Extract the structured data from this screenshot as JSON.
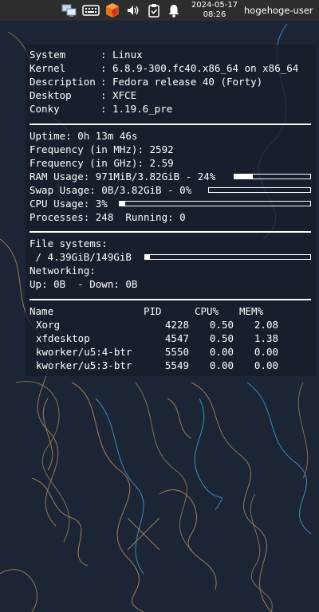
{
  "panel": {
    "date": "2024-05-17",
    "time": "08:26",
    "user": "hogehoge-user",
    "icons": [
      "network-icon",
      "keyboard-icon",
      "package-updater-icon",
      "volume-icon",
      "clipboard-icon",
      "notification-bell-icon"
    ]
  },
  "conky": {
    "system": {
      "system_label": "System",
      "system_value": "Linux",
      "kernel_label": "Kernel",
      "kernel_value": "6.8.9-300.fc40.x86_64 on x86_64",
      "description_label": "Description",
      "description_value": "Fedora release 40 (Forty)",
      "desktop_label": "Desktop",
      "desktop_value": "XFCE",
      "conky_label": "Conky",
      "conky_value": "1.19.6_pre"
    },
    "stats": {
      "uptime": "Uptime: 0h 13m 46s",
      "freq_mhz": "Frequency (in MHz): 2592",
      "freq_ghz": "Frequency (in GHz): 2.59",
      "ram": "RAM Usage: 971MiB/3.82GiB - 24%",
      "ram_percent": 24,
      "swap": "Swap Usage: 0B/3.82GiB - 0%",
      "swap_percent": 0,
      "cpu": "CPU Usage: 3%",
      "cpu_percent": 3,
      "processes": "Processes: 248  Running: 0"
    },
    "fs": {
      "title": "File systems:",
      "root": " / 4.39GiB/149GiB",
      "root_percent": 3,
      "net_title": "Networking:",
      "net": "Up: 0B  - Down: 0B"
    },
    "processes": {
      "headers": [
        "Name",
        "PID",
        "CPU%",
        "MEM%"
      ],
      "rows": [
        [
          "Xorg",
          "4228",
          "0.50",
          "2.08"
        ],
        [
          "xfdesktop",
          "4547",
          "0.50",
          "1.38"
        ],
        [
          "kworker/u5:4-btr",
          "5550",
          "0.00",
          "0.00"
        ],
        [
          "kworker/u5:3-btr",
          "5549",
          "0.00",
          "0.00"
        ]
      ]
    }
  }
}
